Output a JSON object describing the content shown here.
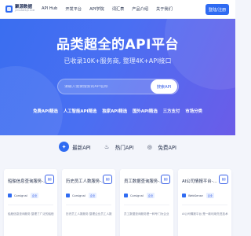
{
  "header": {
    "logo_name": "聚源数据",
    "logo_sub": "JUYUANSHUJU.COM",
    "nav": [
      "API Hub",
      "开发平台",
      "API学院",
      "词汇表",
      "产品介绍",
      "关于我们"
    ],
    "register_label": "登陆/注册"
  },
  "hero": {
    "title": "品类超全的API平台",
    "subtitle": "已收录10K+服务商, 整理4K+API接口",
    "search_placeholder": "请输入需要搜索的API名称",
    "search_button": "搜索API",
    "tags": [
      "免费API精选",
      "人工智能API精选",
      "独家API精选",
      "国外API精选",
      "三方支付",
      "市场分类"
    ]
  },
  "tabs": [
    {
      "label": "最新API",
      "icon": "new-icon"
    },
    {
      "label": "热门API",
      "icon": "fire-icon"
    },
    {
      "label": "免费API",
      "icon": "free-icon"
    }
  ],
  "cards": [
    {
      "title": "船舶信息查询服务-...",
      "provider": "Corsignal",
      "badge": "企业",
      "desc": "船舶信息查询服务 整理了广泛的船舶"
    },
    {
      "title": "历史员工人数服务-...",
      "provider": "Corsignal",
      "badge": "企业",
      "desc": "历史员工人数服务 整理企业员工人数"
    },
    {
      "title": "员工数据查询服务-...",
      "provider": "Corsignal",
      "badge": "企业",
      "desc": "员工数据查询服务是一种专门为企业"
    },
    {
      "title": "AI公司情报平台-...",
      "provider": "WebSense",
      "badge": "企业",
      "desc": "AI公司情报平台 是一款利用先进技术"
    }
  ]
}
